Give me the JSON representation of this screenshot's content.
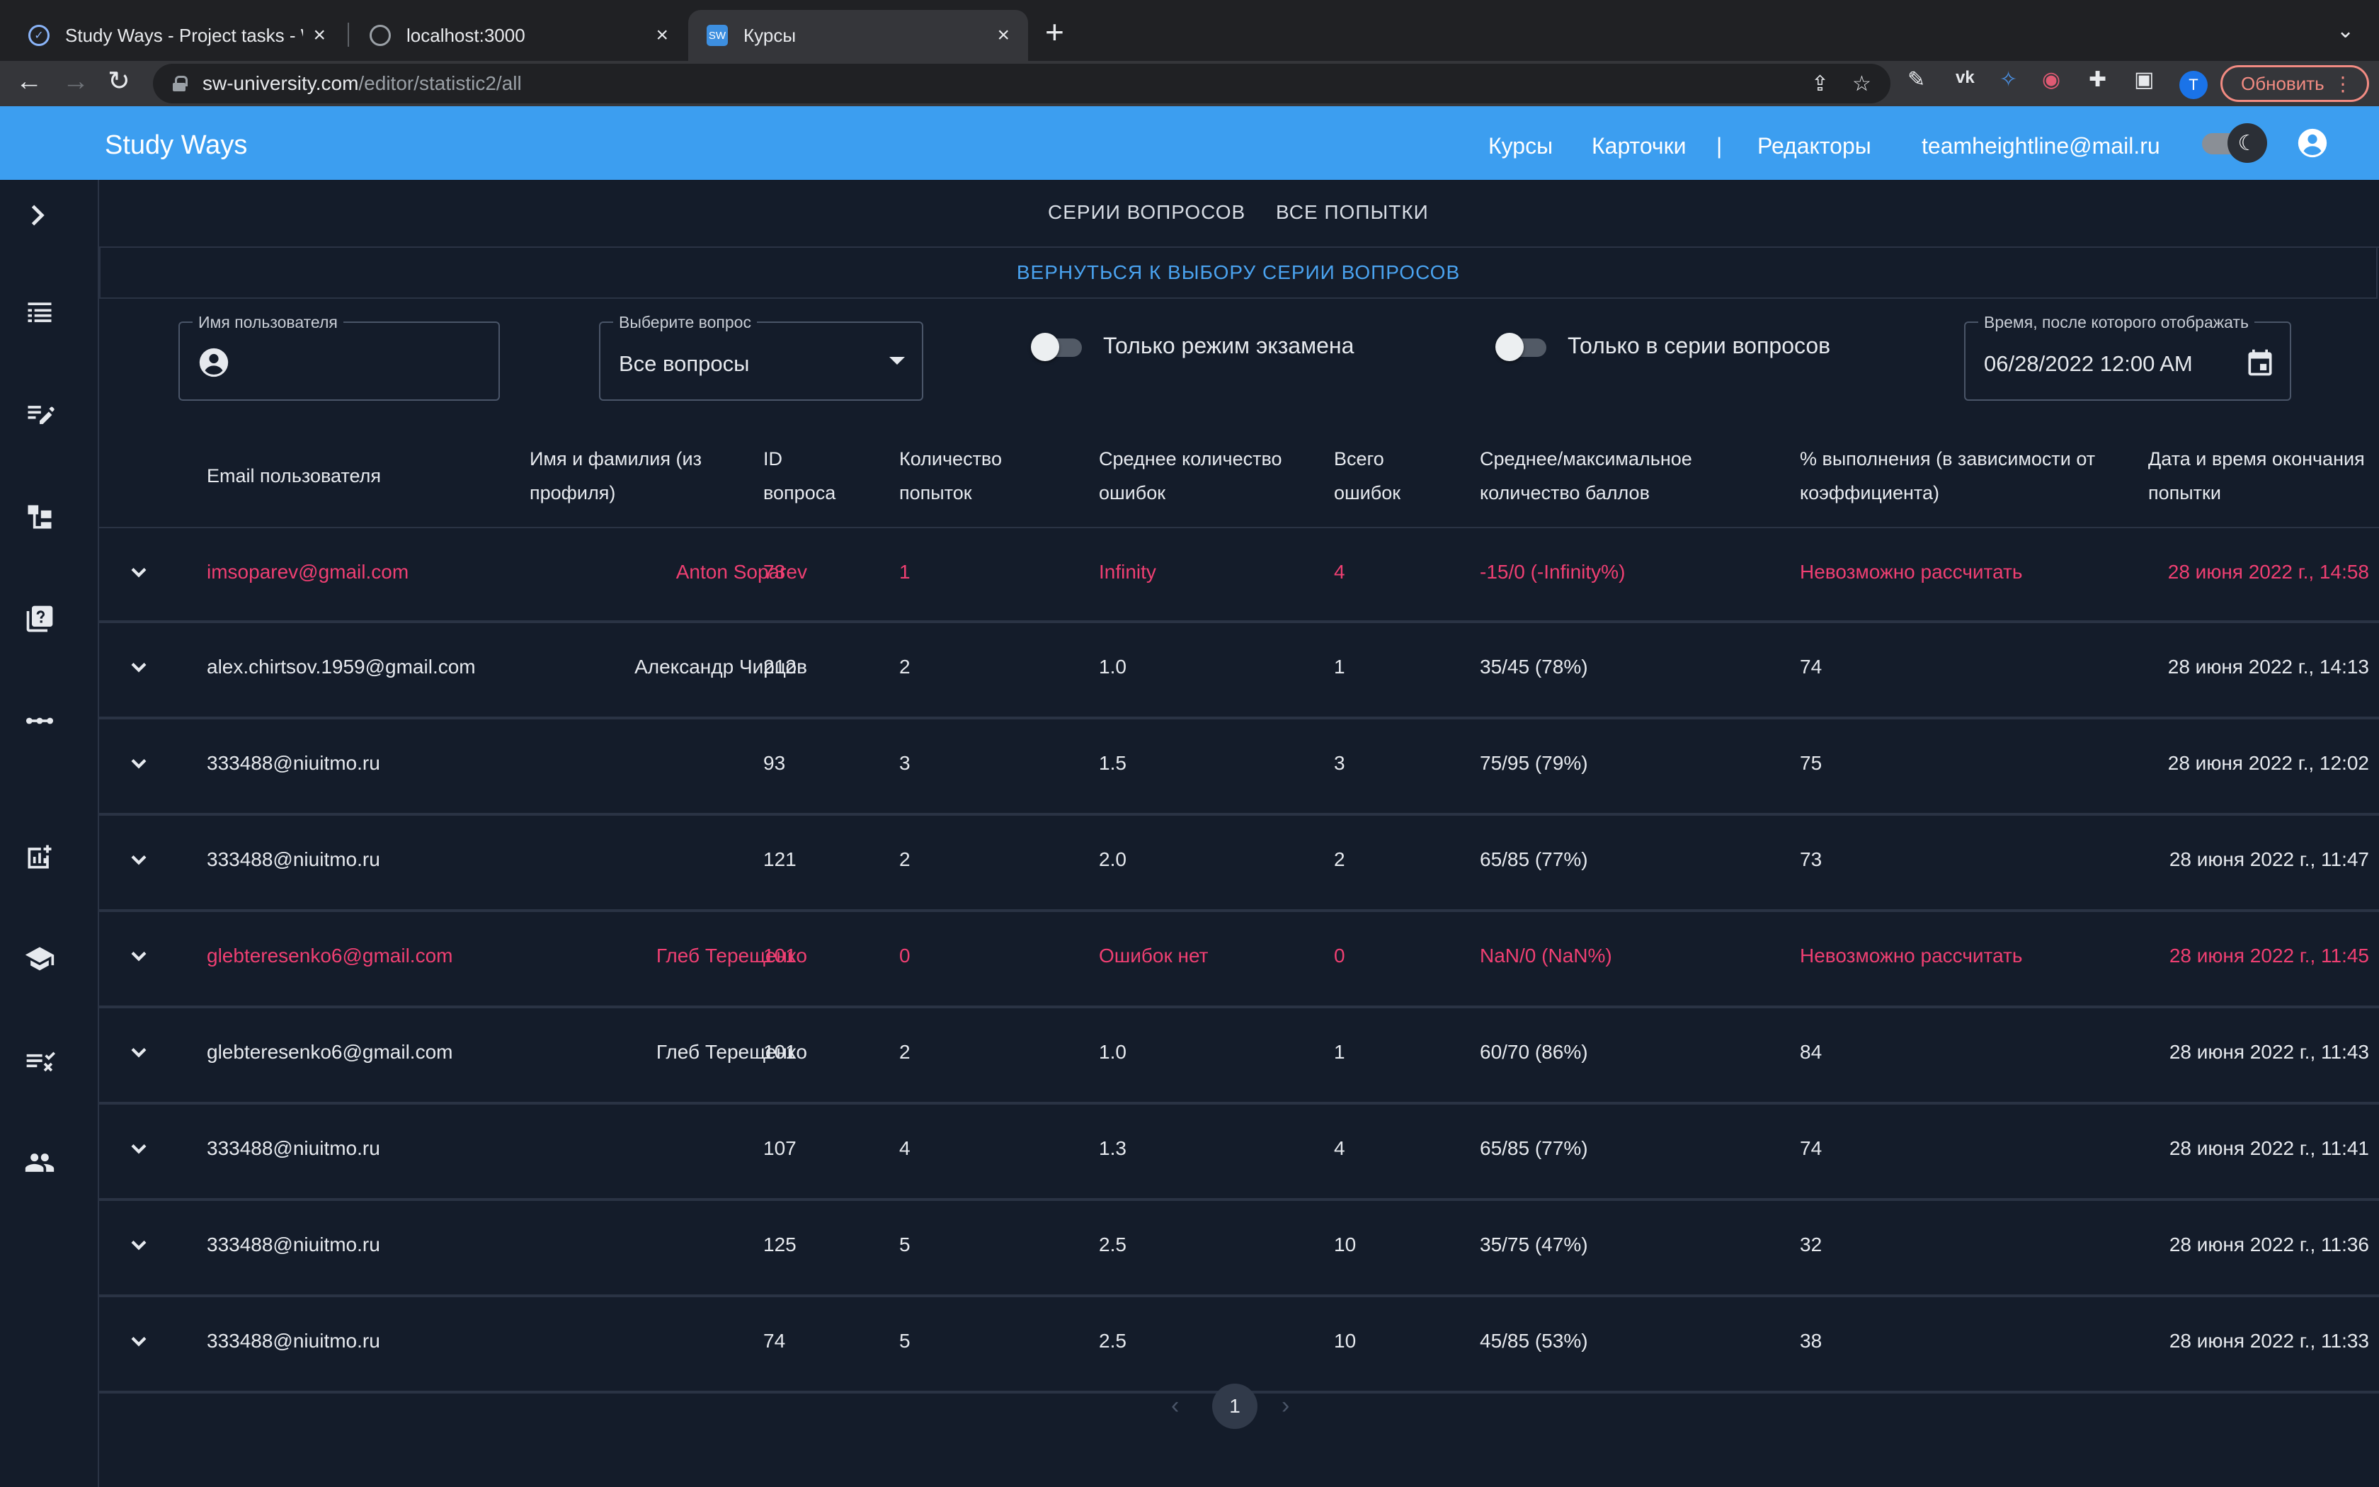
{
  "browser": {
    "tabs": [
      {
        "title": "Study Ways - Project tasks - W"
      },
      {
        "title": "localhost:3000"
      },
      {
        "title": "Курсы"
      }
    ],
    "new_tab": "+",
    "url_host": "sw-university.com",
    "url_path": "/editor/statistic2/all",
    "profile_initial": "T",
    "update_label": "Обновить"
  },
  "appbar": {
    "brand": "Study Ways",
    "nav": {
      "courses": "Курсы",
      "cards": "Карточки",
      "divider": "|",
      "editors": "Редакторы",
      "email": "teamheightline@mail.ru"
    },
    "color": "#3c9ef0"
  },
  "tabs": {
    "series": "Серии вопросов",
    "attempts": "Все попытки"
  },
  "back_link": "ВЕРНУТЬСЯ К ВЫБОРУ СЕРИИ ВОПРОСОВ",
  "filters": {
    "username_label": "Имя пользователя",
    "question_label": "Выберите вопрос",
    "question_value": "Все вопросы",
    "exam_only": "Только режим экзамена",
    "series_only": "Только в серии вопросов",
    "time_label": "Время, после которого отображать",
    "time_value": "06/28/2022 12:00 AM"
  },
  "table": {
    "headers": {
      "email": "Email пользователя",
      "name": "Имя и фамилия (из профиля)",
      "qid": "ID вопроса",
      "attempts": "Количество попыток",
      "avg_errors": "Среднее количество ошибок",
      "total_errors": "Всего ошибок",
      "score": "Среднее/максимальное количество баллов",
      "percent": "% выполнения (в зависимости от коэффициента)",
      "date": "Дата и время окончания попытки"
    },
    "rows": [
      {
        "email": "imsoparev@gmail.com",
        "name": "Anton Soparev",
        "qid": "73",
        "attempts": "1",
        "avg_errors": "Infinity",
        "total_errors": "4",
        "score": "-15/0 (-Infinity%)",
        "percent": "Невозможно рассчитать",
        "date": "28 июня 2022 г., 14:58",
        "error": true
      },
      {
        "email": "alex.chirtsov.1959@gmail.com",
        "name": "Александр Чирцов",
        "qid": "212",
        "attempts": "2",
        "avg_errors": "1.0",
        "total_errors": "1",
        "score": "35/45 (78%)",
        "percent": "74",
        "date": "28 июня 2022 г., 14:13",
        "error": false
      },
      {
        "email": "333488@niuitmo.ru",
        "name": "",
        "qid": "93",
        "attempts": "3",
        "avg_errors": "1.5",
        "total_errors": "3",
        "score": "75/95 (79%)",
        "percent": "75",
        "date": "28 июня 2022 г., 12:02",
        "error": false
      },
      {
        "email": "333488@niuitmo.ru",
        "name": "",
        "qid": "121",
        "attempts": "2",
        "avg_errors": "2.0",
        "total_errors": "2",
        "score": "65/85 (77%)",
        "percent": "73",
        "date": "28 июня 2022 г., 11:47",
        "error": false
      },
      {
        "email": "glebteresenko6@gmail.com",
        "name": "Глеб Терещенко",
        "qid": "101",
        "attempts": "0",
        "avg_errors": "Ошибок нет",
        "total_errors": "0",
        "score": "NaN/0 (NaN%)",
        "percent": "Невозможно рассчитать",
        "date": "28 июня 2022 г., 11:45",
        "error": true
      },
      {
        "email": "glebteresenko6@gmail.com",
        "name": "Глеб Терещенко",
        "qid": "101",
        "attempts": "2",
        "avg_errors": "1.0",
        "total_errors": "1",
        "score": "60/70 (86%)",
        "percent": "84",
        "date": "28 июня 2022 г., 11:43",
        "error": false
      },
      {
        "email": "333488@niuitmo.ru",
        "name": "",
        "qid": "107",
        "attempts": "4",
        "avg_errors": "1.3",
        "total_errors": "4",
        "score": "65/85 (77%)",
        "percent": "74",
        "date": "28 июня 2022 г., 11:41",
        "error": false
      },
      {
        "email": "333488@niuitmo.ru",
        "name": "",
        "qid": "125",
        "attempts": "5",
        "avg_errors": "2.5",
        "total_errors": "10",
        "score": "35/75 (47%)",
        "percent": "32",
        "date": "28 июня 2022 г., 11:36",
        "error": false
      },
      {
        "email": "333488@niuitmo.ru",
        "name": "",
        "qid": "74",
        "attempts": "5",
        "avg_errors": "2.5",
        "total_errors": "10",
        "score": "45/85 (53%)",
        "percent": "38",
        "date": "28 июня 2022 г., 11:33",
        "error": false
      }
    ]
  },
  "pagination": {
    "current": "1"
  },
  "colors": {
    "error": "#ef3f72",
    "link": "#4aa3f0",
    "background": "#141c2a"
  },
  "icons": [
    "task-icon",
    "globe-icon",
    "sw-favicon-icon",
    "back-arrow-icon",
    "forward-arrow-icon",
    "reload-icon",
    "share-icon",
    "star-icon",
    "pen-icon",
    "vk-icon",
    "extension-icon",
    "puzzle-icon",
    "sidepanel-icon",
    "moon-icon",
    "account-icon",
    "chevron-right-icon",
    "table-icon",
    "edit-note-icon",
    "tree-icon",
    "quiz-icon",
    "dots-icon",
    "add-chart-icon",
    "school-icon",
    "checklist-icon",
    "group-icon",
    "person-icon",
    "calendar-icon",
    "chevron-down-icon"
  ]
}
